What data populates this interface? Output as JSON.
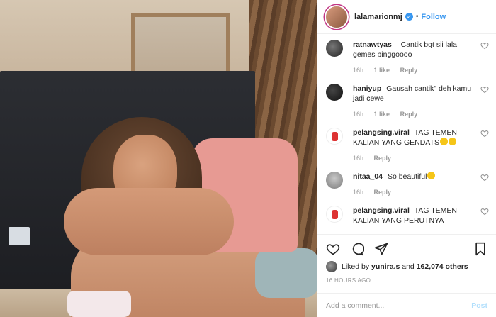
{
  "post": {
    "author": "lalamarionmj",
    "follow_label": "Follow",
    "dot": "•"
  },
  "comments": [
    {
      "user": "ratnawtyas_",
      "text": "Cantik bgt sii lala, gemes binggoooo",
      "age": "16h",
      "likes": "1 like",
      "reply": "Reply"
    },
    {
      "user": "haniyup",
      "text": "Gausah cantik\" deh kamu jadi cewe",
      "age": "16h",
      "likes": "1 like",
      "reply": "Reply"
    },
    {
      "user": "pelangsing.viral",
      "text": "TAG TEMEN KALIAN YANG GENDATS",
      "age": "16h",
      "reply": "Reply"
    },
    {
      "user": "nitaa_04",
      "text": "So beautiful",
      "age": "16h",
      "reply": "Reply"
    },
    {
      "user": "pelangsing.viral",
      "text": "TAG TEMEN KALIAN YANG PERUTNYA"
    }
  ],
  "likes_line": {
    "prefix": "Liked by",
    "liker": "yunira.s",
    "and": "and",
    "count": "162,074 others"
  },
  "timestamp": "16 HOURS AGO",
  "add_comment": {
    "placeholder": "Add a comment...",
    "post_label": "Post"
  },
  "icons": {
    "verified": "verified-badge-icon",
    "like": "heart-icon",
    "comment": "comment-bubble-icon",
    "share": "paper-plane-icon",
    "save": "bookmark-icon"
  },
  "colors": {
    "link": "#3897f0",
    "post_disabled": "#b2dffc",
    "muted": "#999999"
  }
}
